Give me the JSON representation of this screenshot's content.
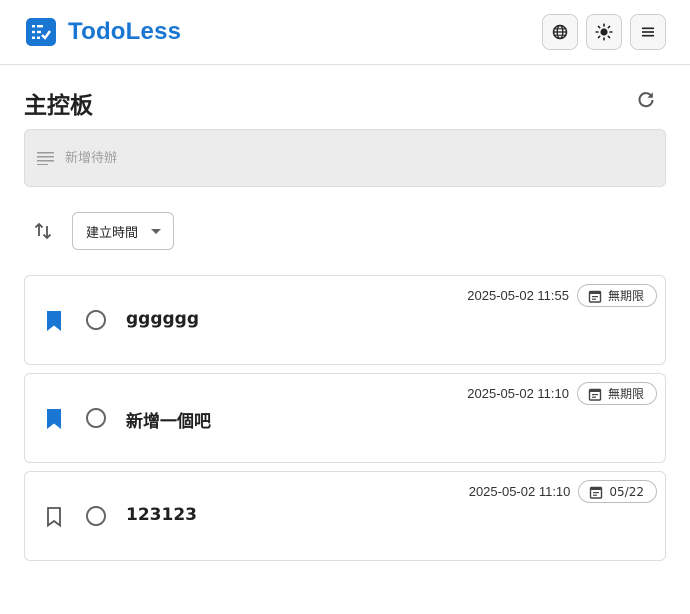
{
  "app": {
    "name": "TodoLess",
    "brand_color": "#1976d2"
  },
  "header": {
    "buttons": [
      "language-icon",
      "theme-light-icon",
      "menu-icon"
    ]
  },
  "main": {
    "title": "主控板",
    "new_todo": {
      "placeholder": "新增待辦",
      "value": ""
    },
    "sort": {
      "selected": "建立時間"
    },
    "todos": [
      {
        "title": "gggggg",
        "created": "2025-05-02 11:55",
        "due": "無期限",
        "bookmarked": true,
        "completed": false
      },
      {
        "title": "新增一個吧",
        "created": "2025-05-02 11:10",
        "due": "無期限",
        "bookmarked": true,
        "completed": false
      },
      {
        "title": "123123",
        "created": "2025-05-02 11:10",
        "due": "05/22",
        "bookmarked": false,
        "completed": false
      }
    ]
  }
}
